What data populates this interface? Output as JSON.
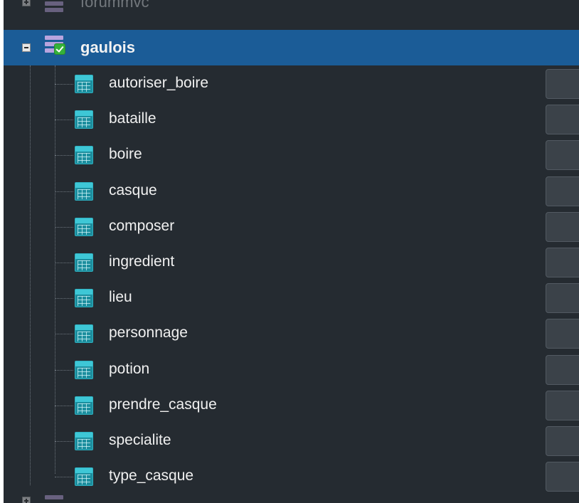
{
  "tree": {
    "above_database": {
      "label": "forummvc",
      "expanded": false
    },
    "selected_database": {
      "label": "gaulois",
      "expanded": true,
      "status": "connected"
    },
    "tables": [
      {
        "label": "autoriser_boire"
      },
      {
        "label": "bataille"
      },
      {
        "label": "boire"
      },
      {
        "label": "casque"
      },
      {
        "label": "composer"
      },
      {
        "label": "ingredient"
      },
      {
        "label": "lieu"
      },
      {
        "label": "personnage"
      },
      {
        "label": "potion"
      },
      {
        "label": "prendre_casque"
      },
      {
        "label": "specialite"
      },
      {
        "label": "type_casque"
      }
    ]
  },
  "colors": {
    "panel_background": "#252b31",
    "selection": "#1b5c97",
    "database_icon": "#b9a4de",
    "table_icon": "#1c8e9e",
    "connected_badge": "#35b23a"
  },
  "icons": {
    "expand": "plus-box-icon",
    "collapse": "minus-box-icon",
    "database": "database-icon",
    "connected": "checkmark-icon",
    "table": "table-icon"
  }
}
